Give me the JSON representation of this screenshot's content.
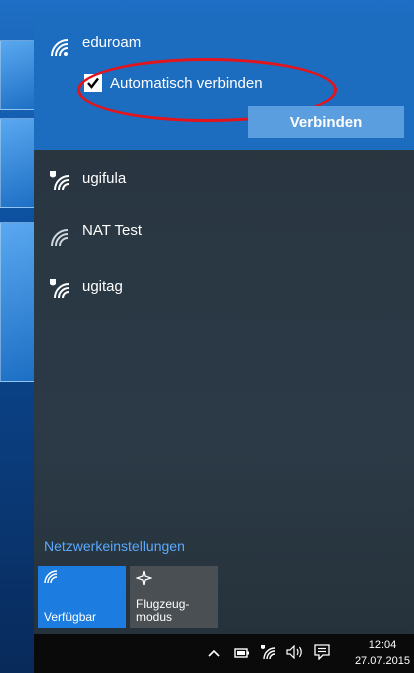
{
  "selected_network": {
    "name": "eduroam",
    "auto_connect_label": "Automatisch verbinden",
    "auto_connect_checked": true,
    "connect_button": "Verbinden"
  },
  "networks": [
    {
      "name": "ugifula",
      "secured": true
    },
    {
      "name": "NAT Test",
      "secured": false
    },
    {
      "name": "ugitag",
      "secured": true
    }
  ],
  "settings_link": "Netzwerkeinstellungen",
  "quick_actions": {
    "wifi_label": "Verfügbar",
    "airplane_label_line1": "Flugzeug-",
    "airplane_label_line2": "modus",
    "wifi_color": "#1c7ce0",
    "airplane_color": "#4a4f54"
  },
  "taskbar": {
    "time": "12:04",
    "date": "27.07.2015"
  },
  "icons": [
    "wifi-icon",
    "secured-wifi-icon",
    "checkmark-icon",
    "airplane-icon",
    "chevron-up-icon",
    "battery-icon",
    "volume-icon",
    "notification-icon"
  ],
  "annotation_color": "#e3141b"
}
